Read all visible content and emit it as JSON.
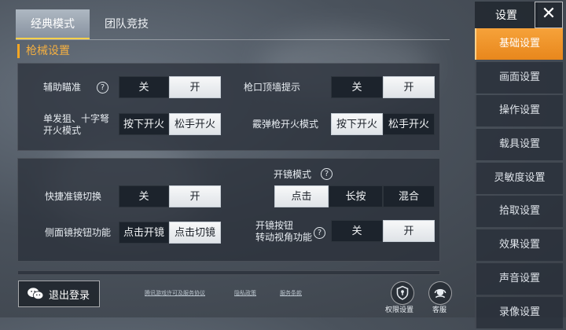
{
  "tabs": [
    {
      "label": "经典模式",
      "active": true
    },
    {
      "label": "团队竞技",
      "active": false
    }
  ],
  "section_title": "枪械设置",
  "panel1": {
    "aim_assist": {
      "label": "辅助瞄准",
      "options": [
        "关",
        "开"
      ],
      "selected": "开"
    },
    "wall_hint": {
      "label": "枪口顶墙提示",
      "options": [
        "关",
        "开"
      ],
      "selected": "开"
    },
    "single_fire": {
      "label_line1": "单发狙、十字弩",
      "label_line2": "开火模式",
      "options": [
        "按下开火",
        "松手开火"
      ],
      "selected": "松手开火"
    },
    "shotgun_fire": {
      "label": "霰弹枪开火模式",
      "options": [
        "按下开火",
        "松手开火"
      ],
      "selected": "按下开火"
    }
  },
  "panel2": {
    "scope_mode": {
      "label": "开镜模式",
      "options": [
        "点击",
        "长按",
        "混合"
      ],
      "selected": "点击"
    },
    "quick_scope": {
      "label": "快捷准镜切换",
      "options": [
        "关",
        "开"
      ],
      "selected": "开"
    },
    "side_scope": {
      "label": "侧面镜按钮功能",
      "options": [
        "点击开镜",
        "点击切镜"
      ],
      "selected": "点击切镜"
    },
    "scope_turn": {
      "label_line1": "开镜按钮",
      "label_line2": "转动视角功能",
      "options": [
        "关",
        "开"
      ],
      "selected": "开"
    }
  },
  "help_glyph": "?",
  "sidebar": {
    "header": "设置",
    "close": "✕",
    "items": [
      {
        "label": "基础设置",
        "active": true
      },
      {
        "label": "画面设置",
        "active": false
      },
      {
        "label": "操作设置",
        "active": false
      },
      {
        "label": "载具设置",
        "active": false
      },
      {
        "label": "灵敏度设置",
        "active": false
      },
      {
        "label": "拾取设置",
        "active": false
      },
      {
        "label": "效果设置",
        "active": false
      },
      {
        "label": "声音设置",
        "active": false
      },
      {
        "label": "录像设置",
        "active": false
      }
    ]
  },
  "footer": {
    "logout": "退出登录",
    "links": [
      "腾讯游戏许可及服务协议",
      "隐私政策",
      "服务条款"
    ],
    "permission": "权限设置",
    "service": "客服"
  },
  "colors": {
    "accent": "#f5a623",
    "tab_underline": "#ffd14a"
  }
}
